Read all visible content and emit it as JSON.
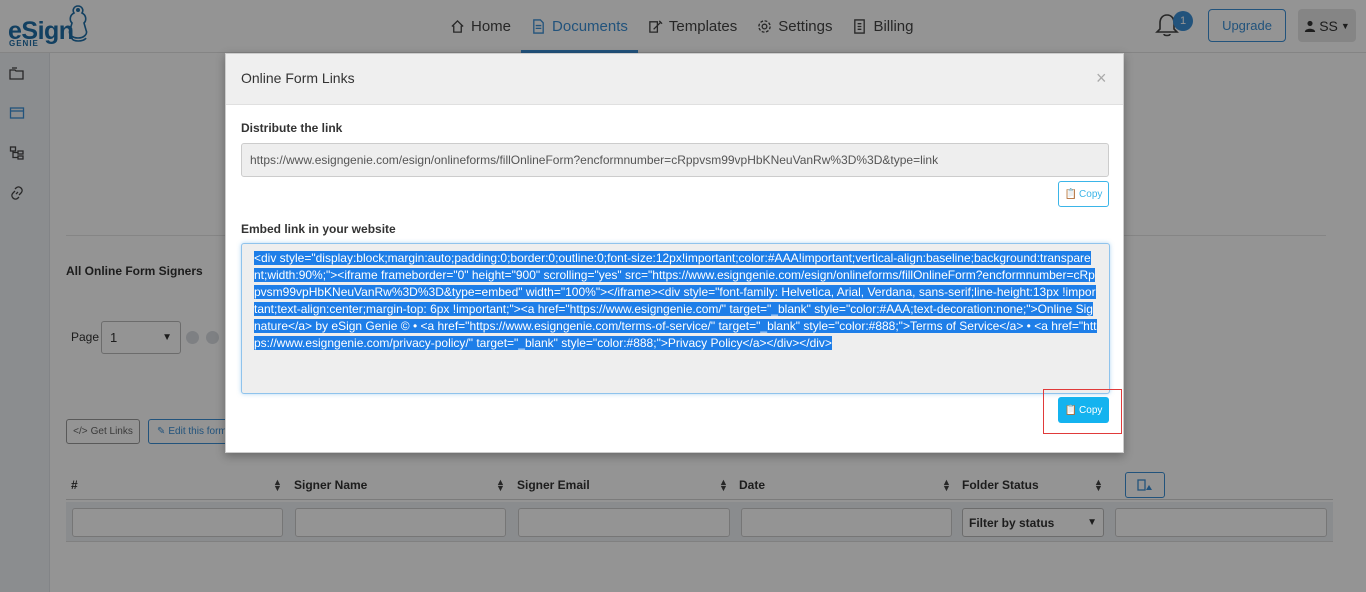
{
  "brand": {
    "name": "eSign",
    "sub": "GENIE"
  },
  "nav": {
    "items": [
      {
        "label": "Home",
        "icon": "home-icon",
        "active": false
      },
      {
        "label": "Documents",
        "icon": "document-icon",
        "active": true
      },
      {
        "label": "Templates",
        "icon": "template-icon",
        "active": false
      },
      {
        "label": "Settings",
        "icon": "gear-icon",
        "active": false
      },
      {
        "label": "Billing",
        "icon": "billing-icon",
        "active": false
      }
    ],
    "notifications_count": "1",
    "upgrade_label": "Upgrade",
    "user_initials": "SS"
  },
  "sidebar": {
    "icons": [
      "folders-icon",
      "window-icon",
      "tree-icon",
      "link-icon"
    ]
  },
  "background": {
    "section_title": "All Online Form Signers",
    "page_label": "Page",
    "page_value": "1",
    "get_links_label": "Get Links",
    "edit_form_label": "Edit this form",
    "table": {
      "columns": [
        "#",
        "Signer Name",
        "Signer Email",
        "Date",
        "Folder Status"
      ],
      "status_filter": "Filter by status"
    }
  },
  "modal": {
    "title": "Online Form Links",
    "close_symbol": "×",
    "distribute_label": "Distribute the link",
    "link_url": "https://www.esigngenie.com/esign/onlineforms/fillOnlineForm?encformnumber=cRppvsm99vpHbKNeuVanRw%3D%3D&type=link",
    "copy_label": "Copy",
    "embed_label": "Embed link in your website",
    "embed_code": "<div style=\"display:block;margin:auto;padding:0;border:0;outline:0;font-size:12px!important;color:#AAA!important;vertical-align:baseline;background:transparent;width:90%;\"><iframe frameborder=\"0\" height=\"900\" scrolling=\"yes\" src=\"https://www.esigngenie.com/esign/onlineforms/fillOnlineForm?encformnumber=cRppvsm99vpHbKNeuVanRw%3D%3D&type=embed\" width=\"100%\"></iframe><div style=\"font-family: Helvetica, Arial, Verdana, sans-serif;line-height:13px !important;text-align:center;margin-top: 6px !important;\"><a href=\"https://www.esigngenie.com/\" target=\"_blank\" style=\"color:#AAA;text-decoration:none;\">Online Signature</a> by eSign Genie © • <a href=\"https://www.esigngenie.com/terms-of-service/\" target=\"_blank\" style=\"color:#888;\">Terms of Service</a> • <a href=\"https://www.esigngenie.com/privacy-policy/\" target=\"_blank\" style=\"color:#888;\">Privacy Policy</a></div></div>"
  },
  "colors": {
    "accent": "#3b8fd6",
    "copy_button": "#14b3ef",
    "selection": "#1e7ee8",
    "highlight": "#e03a3a"
  }
}
